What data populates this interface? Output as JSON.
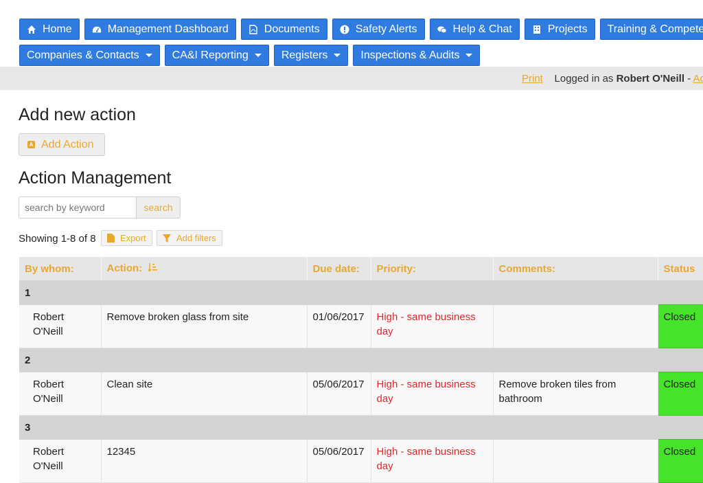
{
  "nav": {
    "row1": [
      {
        "label": "Home",
        "icon": "home-icon"
      },
      {
        "label": "Management Dashboard",
        "icon": "dashboard-icon"
      },
      {
        "label": "Documents",
        "icon": "document-icon"
      },
      {
        "label": "Safety Alerts",
        "icon": "alert-icon"
      },
      {
        "label": "Help & Chat",
        "icon": "chat-icon"
      },
      {
        "label": "Projects",
        "icon": "building-icon"
      },
      {
        "label": "Training & Competency",
        "icon": "training-icon"
      }
    ],
    "row2": [
      {
        "label": "Companies & Contacts"
      },
      {
        "label": "CA&I Reporting"
      },
      {
        "label": "Registers"
      },
      {
        "label": "Inspections & Audits"
      }
    ]
  },
  "topbar": {
    "print": "Print",
    "logged_in_prefix": "Logged in as",
    "user": "Robert O'Neill",
    "separator": "-",
    "account": "Account"
  },
  "add_section": {
    "title": "Add new action",
    "button": "Add Action"
  },
  "management": {
    "title": "Action Management",
    "search_placeholder": "search by keyword",
    "search_button": "search",
    "showing": "Showing 1-8 of 8",
    "export": "Export",
    "add_filters": "Add filters"
  },
  "table": {
    "headers": {
      "by_whom": "By whom:",
      "action": "Action:",
      "due_date": "Due date:",
      "priority": "Priority:",
      "comments": "Comments:",
      "status": "Status"
    },
    "groups": [
      {
        "label": "1",
        "row": {
          "by_whom": "Robert O'Neill",
          "action": "Remove broken glass from site",
          "due": "01/06/2017",
          "priority": "High - same business day",
          "comments": "",
          "status": "Closed"
        }
      },
      {
        "label": "2",
        "row": {
          "by_whom": "Robert O'Neill",
          "action": "Clean site",
          "due": "05/06/2017",
          "priority": "High - same business day",
          "comments": "Remove broken tiles from bathroom",
          "status": "Closed"
        }
      },
      {
        "label": "3",
        "row": {
          "by_whom": "Robert O'Neill",
          "action": "12345",
          "due": "05/06/2017",
          "priority": "High - same business day",
          "comments": "",
          "status": "Closed"
        }
      }
    ]
  },
  "colors": {
    "nav_blue": "#2f7be0",
    "accent_orange": "#e8a82e",
    "priority_red": "#e0262b",
    "status_green": "#46e32a"
  }
}
